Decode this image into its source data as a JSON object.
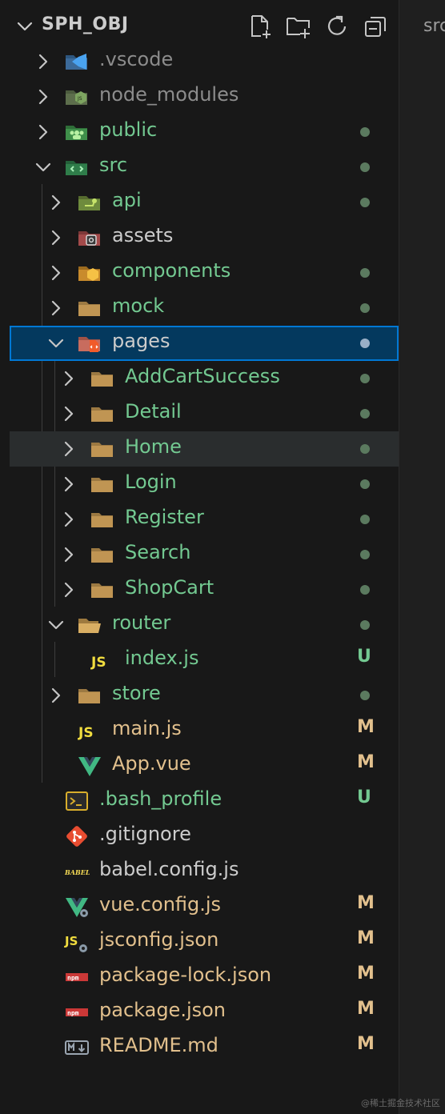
{
  "header": {
    "title": "SPH_OBJ",
    "actions": [
      "new-file-icon",
      "new-folder-icon",
      "refresh-icon",
      "collapse-all-icon"
    ]
  },
  "editor_tab": {
    "label": "src"
  },
  "colors": {
    "git_added": "#73c991",
    "git_modified": "#e2c08d",
    "normal": "#cccccc",
    "ignored": "#8c8c8c",
    "selection_bg": "#04395e",
    "selection_border": "#0078d4"
  },
  "tree": [
    {
      "label": ".vscode",
      "kind": "folder",
      "icon": "vscode-folder-icon",
      "status": ""
    },
    {
      "label": "node_modules",
      "kind": "folder",
      "icon": "node-modules-folder-icon",
      "status": ""
    },
    {
      "label": "public",
      "kind": "folder",
      "icon": "public-folder-icon",
      "status": "dot"
    },
    {
      "label": "src",
      "kind": "folder",
      "icon": "src-folder-icon",
      "status": "dot"
    },
    {
      "label": "api",
      "kind": "folder",
      "icon": "api-folder-icon",
      "status": "dot"
    },
    {
      "label": "assets",
      "kind": "folder",
      "icon": "assets-folder-icon",
      "status": ""
    },
    {
      "label": "components",
      "kind": "folder",
      "icon": "components-folder-icon",
      "status": "dot"
    },
    {
      "label": "mock",
      "kind": "folder",
      "icon": "folder-icon",
      "status": "dot"
    },
    {
      "label": "pages",
      "kind": "folder",
      "icon": "pages-folder-icon",
      "status": "dot"
    },
    {
      "label": "AddCartSuccess",
      "kind": "folder",
      "icon": "folder-icon",
      "status": "dot"
    },
    {
      "label": "Detail",
      "kind": "folder",
      "icon": "folder-icon",
      "status": "dot"
    },
    {
      "label": "Home",
      "kind": "folder",
      "icon": "folder-icon",
      "status": "dot"
    },
    {
      "label": "Login",
      "kind": "folder",
      "icon": "folder-icon",
      "status": "dot"
    },
    {
      "label": "Register",
      "kind": "folder",
      "icon": "folder-icon",
      "status": "dot"
    },
    {
      "label": "Search",
      "kind": "folder",
      "icon": "folder-icon",
      "status": "dot"
    },
    {
      "label": "ShopCart",
      "kind": "folder",
      "icon": "folder-icon",
      "status": "dot"
    },
    {
      "label": "router",
      "kind": "folder",
      "icon": "open-folder-icon",
      "status": "dot"
    },
    {
      "label": "index.js",
      "kind": "file",
      "icon": "js-file-icon",
      "status": "U"
    },
    {
      "label": "store",
      "kind": "folder",
      "icon": "folder-icon",
      "status": "dot"
    },
    {
      "label": "main.js",
      "kind": "file",
      "icon": "js-file-icon",
      "status": "M"
    },
    {
      "label": "App.vue",
      "kind": "file",
      "icon": "vue-file-icon",
      "status": "M"
    },
    {
      "label": ".bash_profile",
      "kind": "file",
      "icon": "terminal-file-icon",
      "status": "U"
    },
    {
      "label": ".gitignore",
      "kind": "file",
      "icon": "git-file-icon",
      "status": ""
    },
    {
      "label": "babel.config.js",
      "kind": "file",
      "icon": "babel-file-icon",
      "status": ""
    },
    {
      "label": "vue.config.js",
      "kind": "file",
      "icon": "vue-config-file-icon",
      "status": "M"
    },
    {
      "label": "jsconfig.json",
      "kind": "file",
      "icon": "jsconfig-file-icon",
      "status": "M"
    },
    {
      "label": "package-lock.json",
      "kind": "file",
      "icon": "npm-file-icon",
      "status": "M"
    },
    {
      "label": "package.json",
      "kind": "file",
      "icon": "npm-file-icon",
      "status": "M"
    },
    {
      "label": "README.md",
      "kind": "file",
      "icon": "markdown-file-icon",
      "status": "M"
    }
  ],
  "watermark": "@稀土掘金技术社区"
}
